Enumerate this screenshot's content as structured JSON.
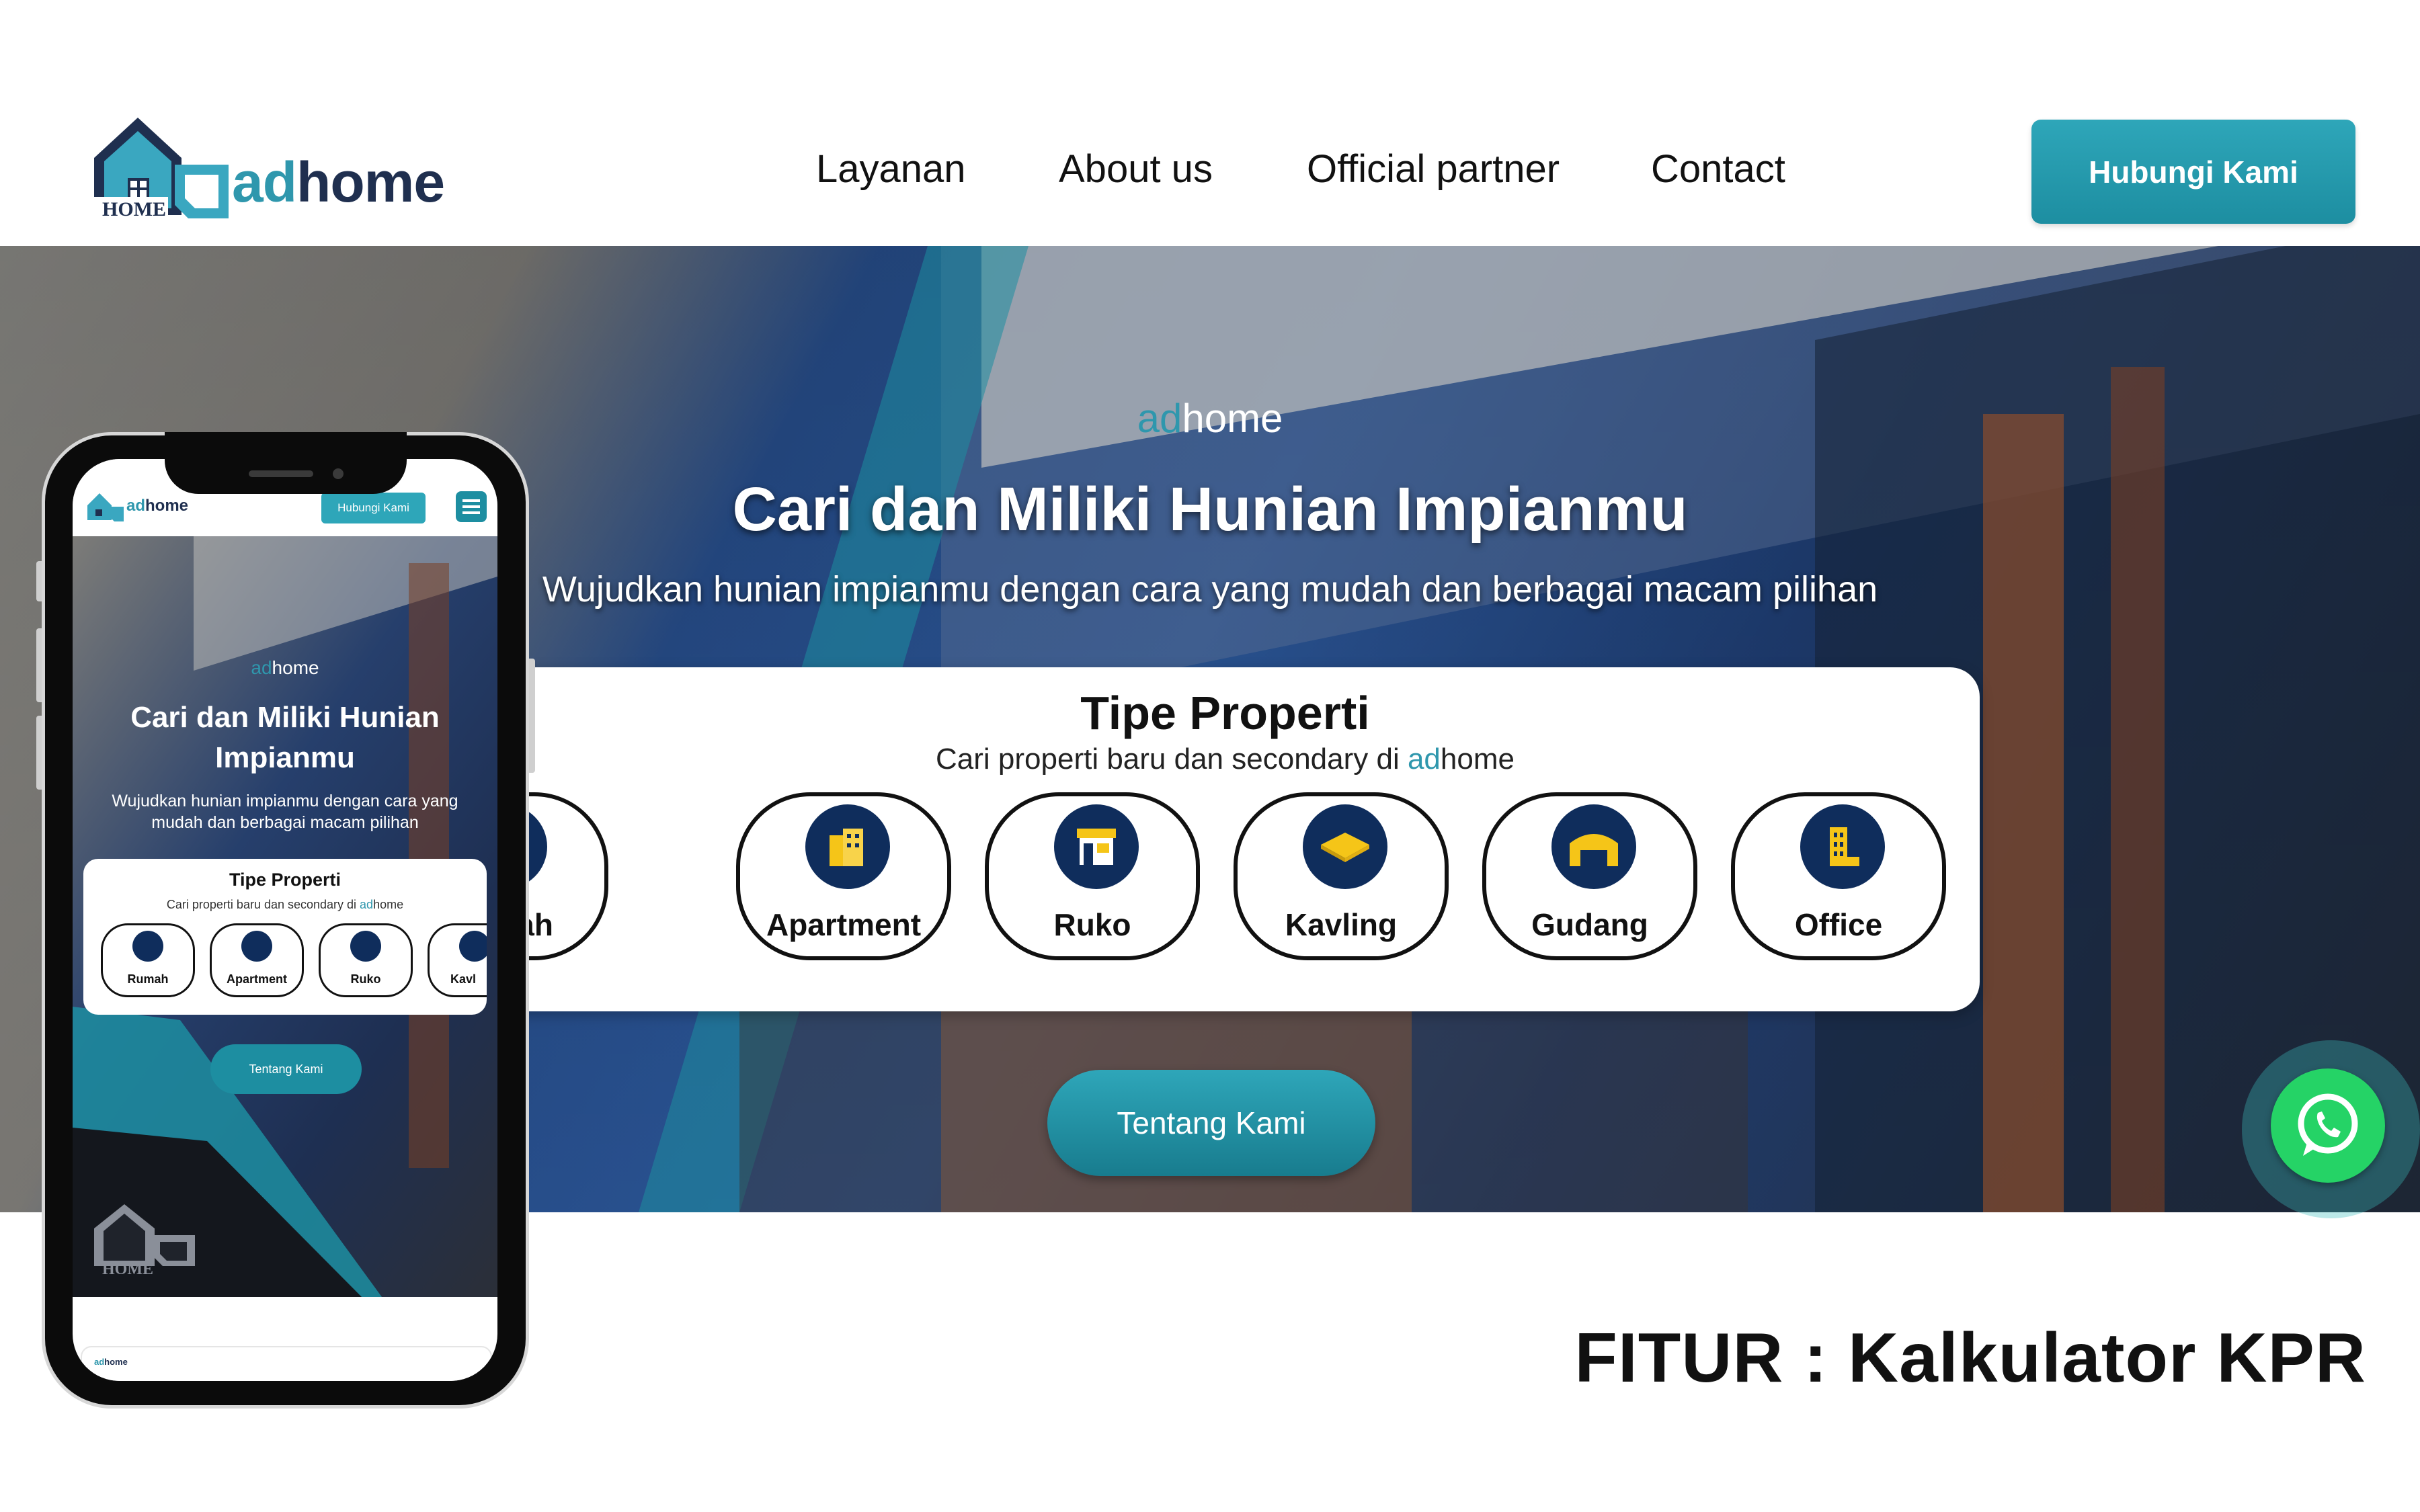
{
  "brand": {
    "ad": "ad",
    "home": "home",
    "badge": "HOME"
  },
  "nav": {
    "items": [
      "Layanan",
      "About us",
      "Official partner",
      "Contact"
    ],
    "cta": "Hubungi Kami"
  },
  "hero": {
    "kicker_ad": "ad",
    "kicker_home": "home",
    "title": "Cari dan Miliki Hunian Impianmu",
    "subtitle": "Wujudkan hunian impianmu dengan cara yang mudah dan berbagai macam pilihan"
  },
  "property_types": {
    "title": "Tipe Properti",
    "subtitle_prefix": "Cari properti baru dan secondary di ",
    "subtitle_ad": "ad",
    "subtitle_home": "home",
    "items": [
      {
        "label": "Rumah",
        "icon": "house-icon"
      },
      {
        "label": "Apartment",
        "icon": "apartment-icon"
      },
      {
        "label": "Ruko",
        "icon": "shop-icon"
      },
      {
        "label": "Kavling",
        "icon": "land-plot-icon"
      },
      {
        "label": "Gudang",
        "icon": "warehouse-icon"
      },
      {
        "label": "Office",
        "icon": "office-building-icon"
      }
    ]
  },
  "about_button": "Tentang Kami",
  "feature_caption": "FITUR : Kalkulator KPR",
  "mobile": {
    "cta": "Hubungi Kami",
    "kicker_ad": "ad",
    "kicker_home": "home",
    "title": "Cari dan Miliki Hunian Impianmu",
    "subtitle": "Wujudkan hunian impianmu dengan cara yang mudah dan berbagai macam pilihan",
    "card_title": "Tipe Properti",
    "card_subtitle_prefix": "Cari properti baru dan secondary di ",
    "card_ad": "ad",
    "card_home": "home",
    "items": [
      "Rumah",
      "Apartment",
      "Ruko",
      "Kavl"
    ],
    "about_button": "Tentang Kami",
    "footer_badge": "HOME",
    "footer_logo_ad": "ad",
    "footer_logo_home": "home"
  },
  "colors": {
    "accent": "#2f97ad",
    "navy": "#0f2d5c",
    "icon_yellow": "#f5c518",
    "whatsapp": "#25d366"
  }
}
